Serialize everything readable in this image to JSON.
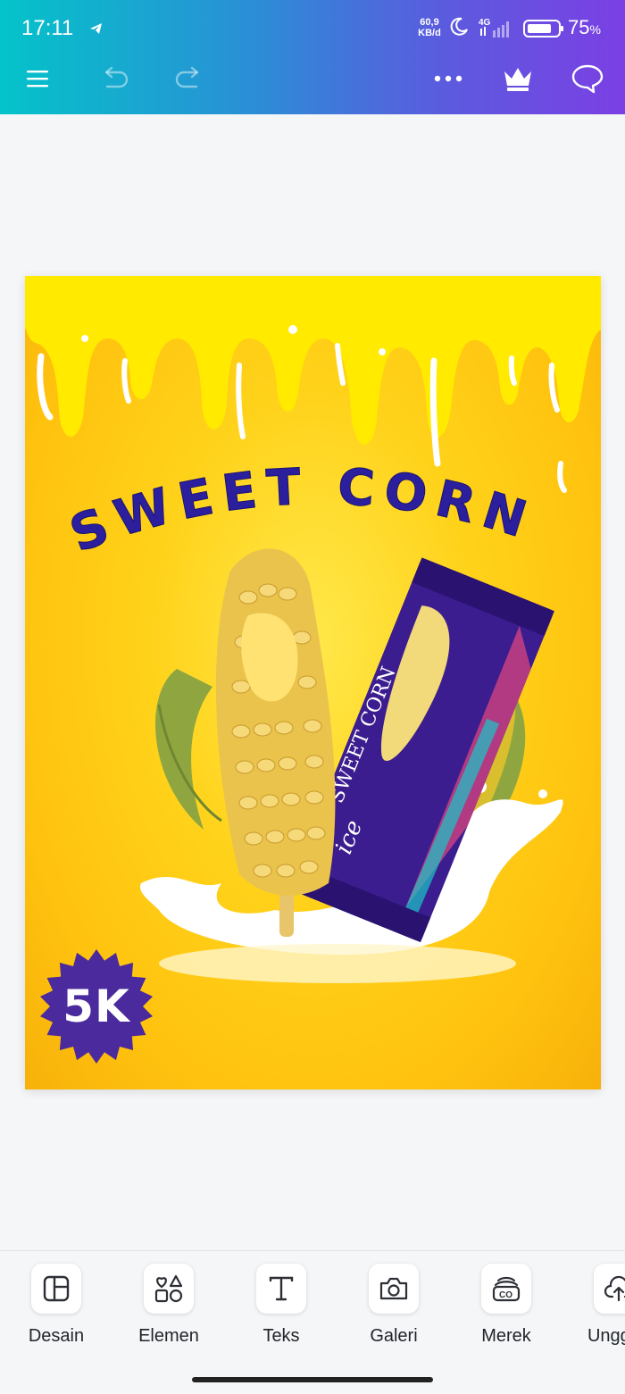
{
  "status_bar": {
    "time": "17:11",
    "net_speed_value": "60,9",
    "net_speed_unit": "KB/d",
    "network": "4G",
    "battery_percent": "75",
    "battery_unit": "%"
  },
  "toolbar": {
    "icons": [
      "menu-icon",
      "undo-icon",
      "redo-icon",
      "more-icon",
      "crown-icon",
      "comment-icon"
    ]
  },
  "design": {
    "title": "SWEET CORN",
    "price_badge": "5K",
    "package_brand": "ice",
    "package_name": "SWEET CORN",
    "colors": {
      "background": "#ffd21a",
      "title": "#2b1f9e",
      "badge": "#4a2a9c",
      "package": "#3c1d8f"
    }
  },
  "bottom_tools": [
    {
      "label": "Desain",
      "icon": "layout-icon"
    },
    {
      "label": "Elemen",
      "icon": "shapes-icon"
    },
    {
      "label": "Teks",
      "icon": "text-icon"
    },
    {
      "label": "Galeri",
      "icon": "camera-icon"
    },
    {
      "label": "Merek",
      "icon": "brand-icon"
    },
    {
      "label": "Unggah",
      "icon": "upload-icon"
    }
  ]
}
